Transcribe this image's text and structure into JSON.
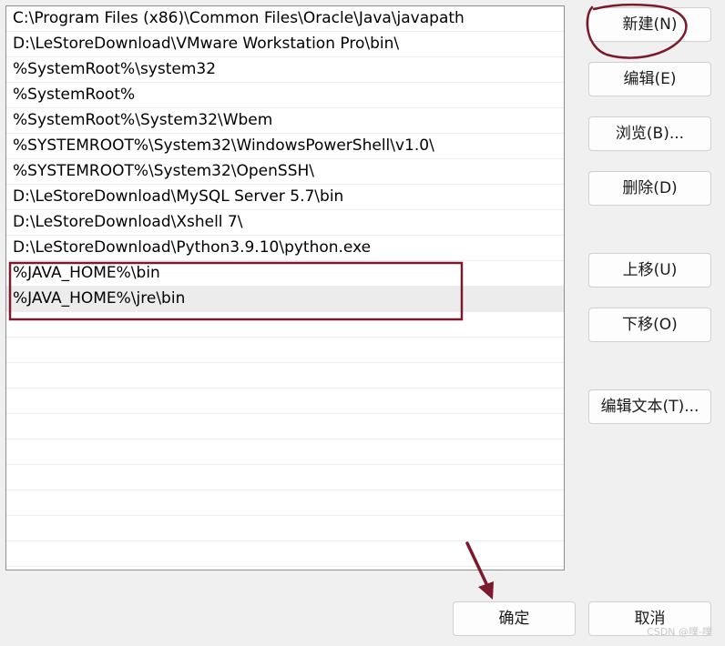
{
  "paths": [
    "C:\\Program Files (x86)\\Common Files\\Oracle\\Java\\javapath",
    "D:\\LeStoreDownload\\VMware Workstation Pro\\bin\\",
    "%SystemRoot%\\system32",
    "%SystemRoot%",
    "%SystemRoot%\\System32\\Wbem",
    "%SYSTEMROOT%\\System32\\WindowsPowerShell\\v1.0\\",
    "%SYSTEMROOT%\\System32\\OpenSSH\\",
    "D:\\LeStoreDownload\\MySQL Server 5.7\\bin",
    "D:\\LeStoreDownload\\Xshell 7\\",
    "D:\\LeStoreDownload\\Python3.9.10\\python.exe",
    "%JAVA_HOME%\\bin",
    "%JAVA_HOME%\\jre\\bin"
  ],
  "selected_index": 11,
  "buttons": {
    "new": "新建(N)",
    "edit": "编辑(E)",
    "browse": "浏览(B)...",
    "delete": "删除(D)",
    "move_up": "上移(U)",
    "move_down": "下移(O)",
    "edit_text": "编辑文本(T)...",
    "ok": "确定",
    "cancel": "取消"
  },
  "watermark": "CSDN @噗-噗",
  "annotation_color": "#7b1a2c"
}
